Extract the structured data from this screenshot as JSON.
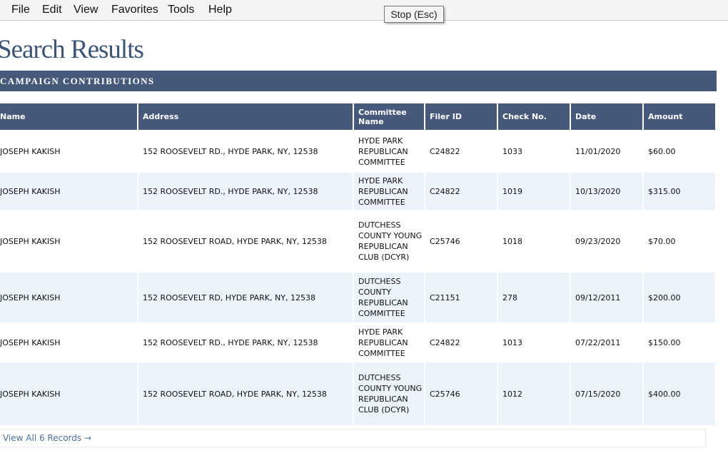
{
  "menu": [
    "File",
    "Edit",
    "View",
    "Favorites",
    "Tools",
    "Help"
  ],
  "tooltip": "Stop (Esc)",
  "page_title": "Search Results",
  "section_title": "CAMPAIGN CONTRIBUTIONS",
  "table": {
    "headers": [
      "Name",
      "Address",
      "Committee Name",
      "Filer ID",
      "Check No.",
      "Date",
      "Amount"
    ],
    "rows": [
      [
        "JOSEPH KAKISH",
        "152 ROOSEVELT RD., HYDE PARK, NY, 12538",
        "HYDE PARK REPUBLICAN COMMITTEE",
        "C24822",
        "1033",
        "11/01/2020",
        "$60.00"
      ],
      [
        "JOSEPH KAKISH",
        "152 ROOSEVELT RD., HYDE PARK, NY, 12538",
        "HYDE PARK REPUBLICAN COMMITTEE",
        "C24822",
        "1019",
        "10/13/2020",
        "$315.00"
      ],
      [
        "JOSEPH KAKISH",
        "152 ROOSEVELT ROAD, HYDE PARK, NY, 12538",
        "DUTCHESS COUNTY YOUNG REPUBLICAN CLUB (DCYR)",
        "C25746",
        "1018",
        "09/23/2020",
        "$70.00"
      ],
      [
        "JOSEPH KAKISH",
        "152 ROOSEVELT RD, HYDE PARK, NY, 12538",
        "DUTCHESS COUNTY REPUBLICAN COMMITTEE",
        "C21151",
        "278",
        "09/12/2011",
        "$200.00"
      ],
      [
        "JOSEPH KAKISH",
        "152 ROOSEVELT RD., HYDE PARK, NY, 12538",
        "HYDE PARK REPUBLICAN COMMITTEE",
        "C24822",
        "1013",
        "07/22/2011",
        "$150.00"
      ],
      [
        "JOSEPH KAKISH",
        "152 ROOSEVELT ROAD, HYDE PARK, NY, 12538",
        "DUTCHESS COUNTY YOUNG REPUBLICAN CLUB (DCYR)",
        "C25746",
        "1012",
        "07/15/2020",
        "$400.00"
      ]
    ]
  },
  "view_all_label": "View All 6 Records →",
  "colors": {
    "header_bg": "#46597a",
    "title": "#3b5577",
    "row_alt": "#ecf3fb",
    "link": "#4f6f9a"
  }
}
